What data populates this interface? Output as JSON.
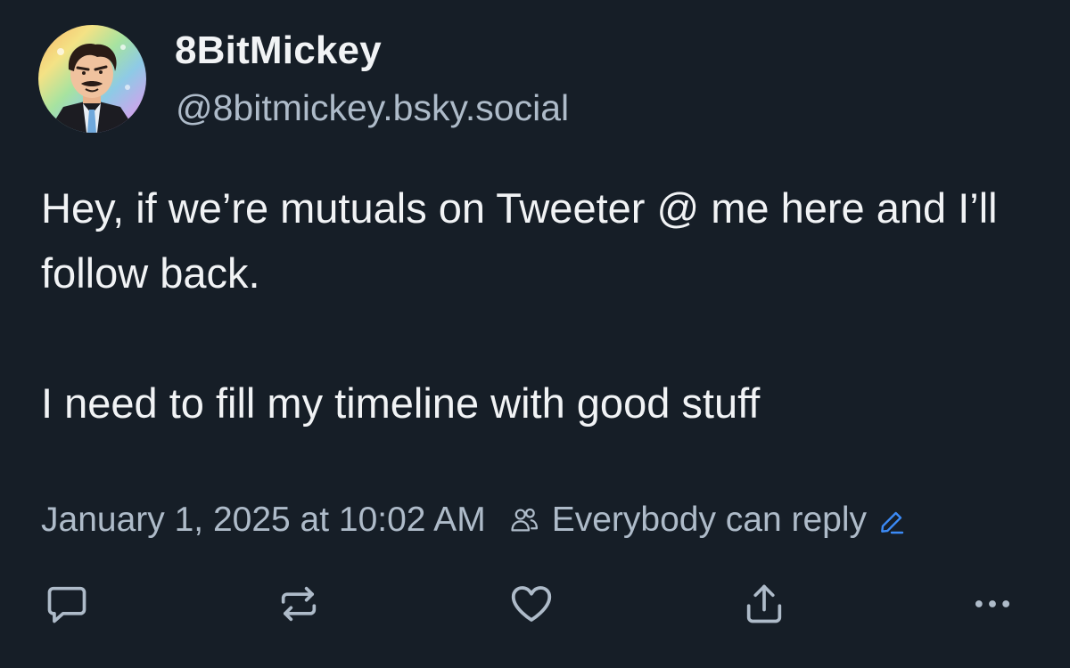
{
  "post": {
    "author": {
      "display_name": "8BitMickey",
      "handle": "@8bitmickey.bsky.social",
      "avatar_icon": "avatar-cartoon-man-rainbow"
    },
    "text": {
      "paragraph_1": "Hey, if we’re mutuals on Tweeter @ me here and I’ll follow back.",
      "paragraph_2": "I need to fill my timeline with good stuff"
    },
    "timestamp": "January 1, 2025 at 10:02 AM",
    "reply_setting": "Everybody can reply",
    "actions": {
      "reply_icon": "comment-icon",
      "repost_icon": "repost-icon",
      "like_icon": "heart-icon",
      "share_icon": "share-icon",
      "more_icon": "ellipsis-icon"
    }
  },
  "colors": {
    "background": "#161e27",
    "text_primary": "#f1f3f5",
    "text_secondary": "#aebbc9",
    "accent": "#3b8af6"
  }
}
